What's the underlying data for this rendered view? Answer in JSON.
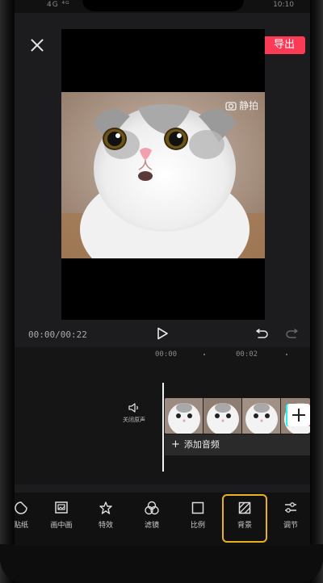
{
  "status_bar": {
    "signal": "4G ⁴ᴳ",
    "time": "10:10"
  },
  "top_bar": {
    "export_label": "导出"
  },
  "preview": {
    "watermark_text": "静拍"
  },
  "playback": {
    "timecode": "00:00/00:22"
  },
  "timeline": {
    "ruler": [
      "00:00",
      "00:02"
    ],
    "mute_label": "关闭原声",
    "add_audio_label": "添加音频"
  },
  "toolbar": {
    "items": [
      {
        "label": "贴纸",
        "icon": "sticker-icon"
      },
      {
        "label": "画中画",
        "icon": "picture-in-picture-icon"
      },
      {
        "label": "特效",
        "icon": "effects-star-icon"
      },
      {
        "label": "滤镜",
        "icon": "filter-icon"
      },
      {
        "label": "比例",
        "icon": "ratio-icon"
      },
      {
        "label": "背景",
        "icon": "background-icon",
        "active": true
      },
      {
        "label": "调节",
        "icon": "adjust-sliders-icon"
      }
    ]
  },
  "colors": {
    "export": "#fb3a55",
    "highlight": "#e9b21c",
    "panel": "#1c1c1e"
  }
}
